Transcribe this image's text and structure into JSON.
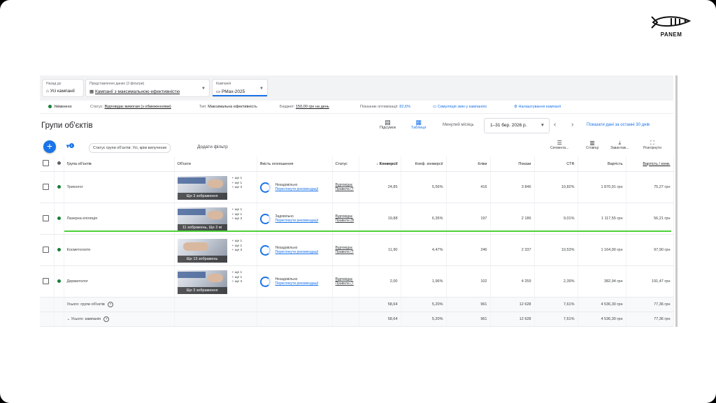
{
  "brand": {
    "logo_text": "PANEM"
  },
  "topbar": {
    "back": {
      "label": "Назад до",
      "value": "Усі кампанії"
    },
    "view": {
      "label": "Представлення даних (3 фільтри)",
      "value": "Кампанії з максимальною ефективністю"
    },
    "campaign": {
      "label": "Кампанія",
      "value": "PMax-2025"
    }
  },
  "statusbar": {
    "status": "Увімкнено",
    "status_label": "Статус:",
    "status_value": "Відповідає вимогам (з обмеженнями)",
    "type_label": "Тип:",
    "type_value": "Максимальна ефективність",
    "budget_label": "Бюджет:",
    "budget_value": "150,00 грн на день",
    "opt_label": "Показник оптимізації:",
    "opt_value": "82,6%",
    "sim_link": "Симуляція змін у кампаніях",
    "settings_link": "Налаштування кампанії"
  },
  "page": {
    "title": "Групи об'єктів",
    "summary_btn": "Підсумок",
    "table_btn": "Таблиця",
    "date_label": "Минулий місяць",
    "date_value": "1–31 бер. 2026 р.",
    "show30": "Показати дані за останні 30 днів"
  },
  "filters": {
    "badge": "1",
    "chip": "Статус групи об'єктів: Усі, крім вилучених",
    "add_filter": "Додати фільтр",
    "segment": "Сегмента...",
    "columns": "Стовпці",
    "download": "Завантаж...",
    "expand": "Розгорнути"
  },
  "table": {
    "headers": [
      "Група об'єктів",
      "Об'єкти",
      "Якість оголошення",
      "Статус",
      "Конверсії",
      "Коеф. конверсії",
      "Кліки",
      "Покази",
      "CTR",
      "Вартість",
      "Вартість / конв."
    ],
    "rows": [
      {
        "name": "Трихолог",
        "plus": [
          "+ ще 1",
          "+ ще 1",
          "+ ще 3"
        ],
        "thumb_caption": "Ще 3 зображення",
        "thumb_title": "ДОСЛІДЖЕННЯ ШКІРИ ГОЛОВИ",
        "quality": "Незадовільно",
        "quality_link": "Переглянути рекомендації",
        "status": [
          "Відповідає",
          "Правила (Т"
        ],
        "conv": "24,85",
        "conv_rate": "5,56%",
        "clicks": "416",
        "impr": "3 846",
        "ctr": "10,82%",
        "cost": "1 870,91 грн",
        "cpa": "75,27 грн"
      },
      {
        "name": "Лазерна епіляція",
        "plus": [
          "+ ще 1",
          "+ ще 1",
          "+ ще 3"
        ],
        "thumb_caption": "11 зображень, Ще 2 ві",
        "thumb_title": "БЕЗБОЛІСНА ЛАЗЕРНА ЕПІЛЯЦІЯ",
        "quality": "Задовільно",
        "quality_link": "Переглянути рекомендації",
        "status": [
          "Відповідає",
          "Правила (В"
        ],
        "conv": "19,88",
        "conv_rate": "6,35%",
        "clicks": "197",
        "impr": "2 186",
        "ctr": "9,01%",
        "cost": "1 117,55 грн",
        "cpa": "56,21 грн"
      },
      {
        "name": "Косметологія",
        "plus": [
          "+ ще 1",
          "+ ще 1",
          "+ ще 3"
        ],
        "thumb_caption": "Ще 13 зображень",
        "thumb_title": "",
        "quality": "Незадовільно",
        "quality_link": "Переглянути рекомендації",
        "status": [
          "Відповідає",
          "Правила (Т"
        ],
        "conv": "11,90",
        "conv_rate": "4,47%",
        "clicks": "246",
        "impr": "2 337",
        "ctr": "10,53%",
        "cost": "1 164,90 грн",
        "cpa": "97,90 грн"
      },
      {
        "name": "Дерматолог",
        "plus": [
          "+ ще 1",
          "+ ще 1",
          "+ ще 3"
        ],
        "thumb_caption": "Ще 3 зображення",
        "thumb_title": "ДОСЛІДЖЕННЯ ДЕРМАТОЛОГА",
        "quality": "Незадовільно",
        "quality_link": "Переглянути рекомендації",
        "status": [
          "Відповідає",
          "Правила (Т"
        ],
        "conv": "2,00",
        "conv_rate": "1,96%",
        "clicks": "102",
        "impr": "4 259",
        "ctr": "2,39%",
        "cost": "382,94 грн",
        "cpa": "191,47 грн"
      }
    ],
    "totals": [
      {
        "label": "Усього: групи об'єктів",
        "conv": "58,64",
        "conv_rate": "5,20%",
        "clicks": "961",
        "impr": "12 628",
        "ctr": "7,61%",
        "cost": "4 536,30 грн",
        "cpa": "77,36 грн"
      },
      {
        "label": "Усього: кампанія",
        "conv": "58,64",
        "conv_rate": "5,20%",
        "clicks": "961",
        "impr": "12 628",
        "ctr": "7,61%",
        "cost": "4 536,30 грн",
        "cpa": "77,36 грн"
      }
    ]
  },
  "colors": {
    "accent": "#1a73e8",
    "enabled": "#188038",
    "highlight_line": "#4cd137"
  }
}
